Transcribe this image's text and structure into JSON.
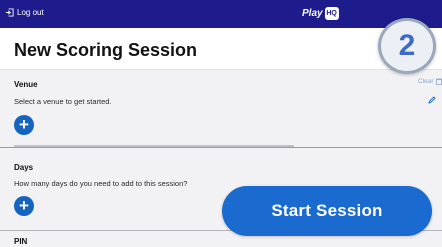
{
  "topbar": {
    "logout_label": "Log out",
    "brand_text": "Play",
    "brand_badge_text": "HQ"
  },
  "header": {
    "title": "New Scoring Session"
  },
  "step_indicator": {
    "number": "2"
  },
  "venue": {
    "heading": "Venue",
    "clear_label": "Clear",
    "prompt": "Select a venue to get started.",
    "add_label": "+"
  },
  "days": {
    "heading": "Days",
    "prompt": "How many days do you need to add to this session?",
    "add_label": "+"
  },
  "pin": {
    "heading": "PIN"
  },
  "actions": {
    "start_label": "Start Session"
  },
  "colors": {
    "topbar_bg": "#1e1c8c",
    "primary_blue": "#1565c0",
    "start_button_blue": "#1a6ad0",
    "step_number_blue": "#3f6ac8",
    "clear_link": "#8aa6cf"
  },
  "icons": {
    "logout": "logout-icon",
    "trash": "trash-icon",
    "edit": "pencil-icon"
  }
}
